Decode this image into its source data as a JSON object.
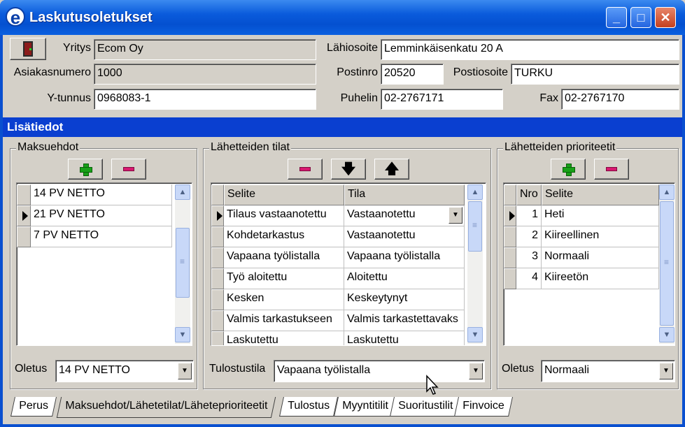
{
  "window": {
    "title": "Laskutusoletukset",
    "icon": "e-app-icon",
    "controls": [
      "minimize",
      "maximize",
      "close"
    ]
  },
  "company": {
    "yritys_label": "Yritys",
    "yritys_value": "Ecom Oy",
    "asiakasnumero_label": "Asiakasnumero",
    "asiakasnumero_value": "1000",
    "ytunnus_label": "Y-tunnus",
    "ytunnus_value": "0968083-1",
    "lahiosoite_label": "Lähiosoite",
    "lahiosoite_value": "Lemminkäisenkatu 20 A",
    "postinro_label": "Postinro",
    "postinro_value": "20520",
    "postiosoite_label": "Postiosoite",
    "postiosoite_value": "TURKU",
    "puhelin_label": "Puhelin",
    "puhelin_value": "02-2767171",
    "fax_label": "Fax",
    "fax_value": "02-2767170"
  },
  "banner": "Lisätiedot",
  "maksuehdot": {
    "title": "Maksuehdot",
    "rows": [
      "14 PV NETTO",
      "21 PV NETTO",
      "7 PV NETTO"
    ],
    "current_row": 1,
    "oletus_label": "Oletus",
    "oletus_value": "14 PV NETTO"
  },
  "lahetteiden_tilat": {
    "title": "Lähetteiden tilat",
    "columns": [
      "Selite",
      "Tila"
    ],
    "rows": [
      {
        "selite": "Tilaus vastaanotettu",
        "tila": "Vastaanotettu"
      },
      {
        "selite": "Kohdetarkastus",
        "tila": "Vastaanotettu"
      },
      {
        "selite": "Vapaana työlistalla",
        "tila": "Vapaana työlistalla"
      },
      {
        "selite": "Työ aloitettu",
        "tila": "Aloitettu"
      },
      {
        "selite": "Kesken",
        "tila": "Keskeytynyt"
      },
      {
        "selite": "Valmis tarkastukseen",
        "tila": "Valmis tarkastettavaks"
      },
      {
        "selite": "Laskutettu",
        "tila": "Laskutettu"
      }
    ],
    "current_row": 0,
    "tulostustila_label": "Tulostustila",
    "tulostustila_value": "Vapaana työlistalla"
  },
  "prioriteetit": {
    "title": "Lähetteiden prioriteetit",
    "columns": [
      "Nro",
      "Selite"
    ],
    "rows": [
      {
        "nro": "1",
        "selite": "Heti"
      },
      {
        "nro": "2",
        "selite": "Kiireellinen"
      },
      {
        "nro": "3",
        "selite": "Normaali"
      },
      {
        "nro": "4",
        "selite": "Kiireetön"
      }
    ],
    "current_row": 0,
    "oletus_label": "Oletus",
    "oletus_value": "Normaali"
  },
  "tabs": [
    "Perus",
    "Maksuehdot/Lähetetilat/Läheteprioriteetit",
    "Tulostus",
    "Myyntitilit",
    "Suoritustilit",
    "Finvoice"
  ],
  "active_tab": 1
}
